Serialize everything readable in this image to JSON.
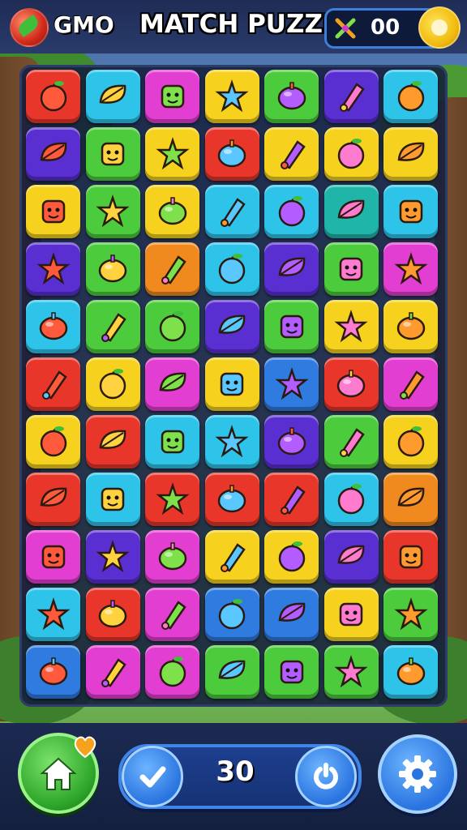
{
  "header": {
    "brand": "GMO",
    "title": "MATCH PUZZLE",
    "score": "00"
  },
  "footer": {
    "moves": "30"
  },
  "colors": {
    "red": "#e8362a",
    "cyan": "#2ec4ea",
    "magenta": "#e23ed1",
    "yellow": "#f6d21f",
    "green": "#4ccb3c",
    "purple": "#5a2fd1",
    "orange": "#f08a1e",
    "blue": "#2f7be0",
    "teal": "#1fb5a8"
  },
  "grid": [
    [
      "red:ring-icon",
      "cyan:puzzle-piece-icon",
      "magenta:apple-icon",
      "yellow:leaf-icon",
      "green:peach-face-icon",
      "purple:tomato-icon",
      "cyan:pinecone-icon"
    ],
    [
      "purple:crate-icon",
      "green:sunflower-icon",
      "yellow:drop-leaf-icon",
      "red:cotton-candy-icon",
      "yellow:sun-gear-icon",
      "yellow:cherries-icon",
      "yellow:pear-icon"
    ],
    [
      "yellow:smiley-fruit-icon",
      "green:pepper-monster-icon",
      "yellow:grape-face-icon",
      "cyan:melon-icon",
      "cyan:jar-icon",
      "teal:peach-icon",
      "cyan:carrot-icon"
    ],
    [
      "purple:star-cookie-icon",
      "green:banana-icon",
      "orange:feather-leaf-icon",
      "cyan:mushroom-icon",
      "purple:sparkle-cross-icon",
      "green:orange-splash-icon",
      "magenta:tomato-icon"
    ],
    [
      "cyan:flower-face-icon",
      "green:sushi-icon",
      "green:green-leaf-icon",
      "purple:sun-flower-icon",
      "green:eggplant-icon",
      "yellow:popsicle-icon",
      "yellow:chili-icon"
    ],
    [
      "red:eggplant-icon",
      "yellow:green-apple-icon",
      "magenta:feather-icon",
      "yellow:ice-pop-icon",
      "blue:kite-icon",
      "red:tomato-icon",
      "magenta:sunflower-icon"
    ],
    [
      "yellow:popsicle-icon",
      "red:orange-icon",
      "cyan:ring-icon",
      "cyan:cookie-face-icon",
      "purple:sparkle-icon",
      "green:carrot-icon",
      "yellow:soda-can-icon"
    ],
    [
      "red:plum-icon",
      "cyan:starburst-icon",
      "red:red-leaf-icon",
      "red:grape-icon",
      "red:lemon-icon",
      "cyan:bird-icon",
      "orange:herb-icon"
    ],
    [
      "magenta:dragon-icon",
      "purple:chili-icon",
      "magenta:heart-fruit-icon",
      "yellow:lettuce-icon",
      "yellow:pencil-icon",
      "purple:eggplant-icon",
      "red:flower-icon"
    ],
    [
      "cyan:orange-face-icon",
      "red:melon-slice-icon",
      "magenta:green-smiley-icon",
      "blue:plum-icon",
      "blue:tomato-icon",
      "yellow:orange-blob-icon",
      "green:red-leaf-icon"
    ],
    [
      "blue:popsicle-icon",
      "magenta:cup-icon",
      "magenta:lemon-icon",
      "green:apple-icon",
      "green:skull-face-icon",
      "green:mug-icon",
      "cyan:yarn-ball-icon"
    ]
  ]
}
